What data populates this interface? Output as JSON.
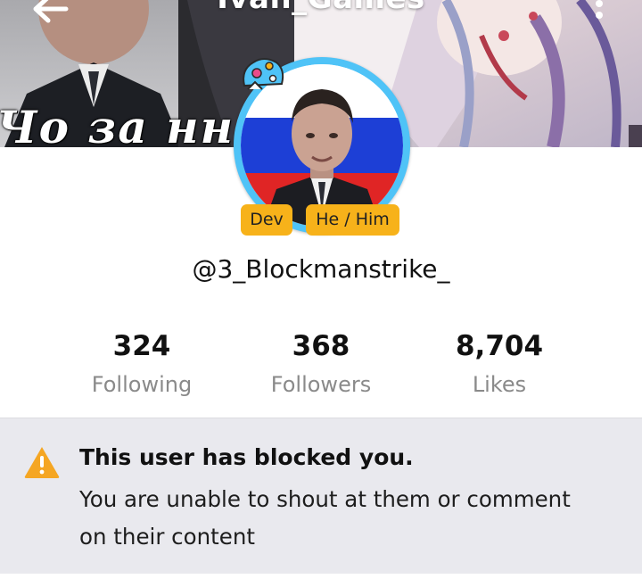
{
  "header": {
    "title": "Ivan_Games",
    "banner_caption": "Чо за нн"
  },
  "profile": {
    "badges": [
      "Dev",
      "He / Him"
    ],
    "username": "@3_Blockmanstrike_"
  },
  "stats": [
    {
      "value": "324",
      "label": "Following"
    },
    {
      "value": "368",
      "label": "Followers"
    },
    {
      "value": "8,704",
      "label": "Likes"
    }
  ],
  "notice": {
    "title": "This user has blocked you.",
    "body": "You are unable to shout at them or comment on their content"
  },
  "colors": {
    "badge": "#f7b21a",
    "avatar_ring": "#4fc3f7",
    "notice_bg": "#e9e9ee",
    "warning": "#f5a623"
  },
  "icons": {
    "back": "arrow-left-icon",
    "menu": "kebab-menu-icon",
    "warning": "warning-triangle-icon"
  }
}
